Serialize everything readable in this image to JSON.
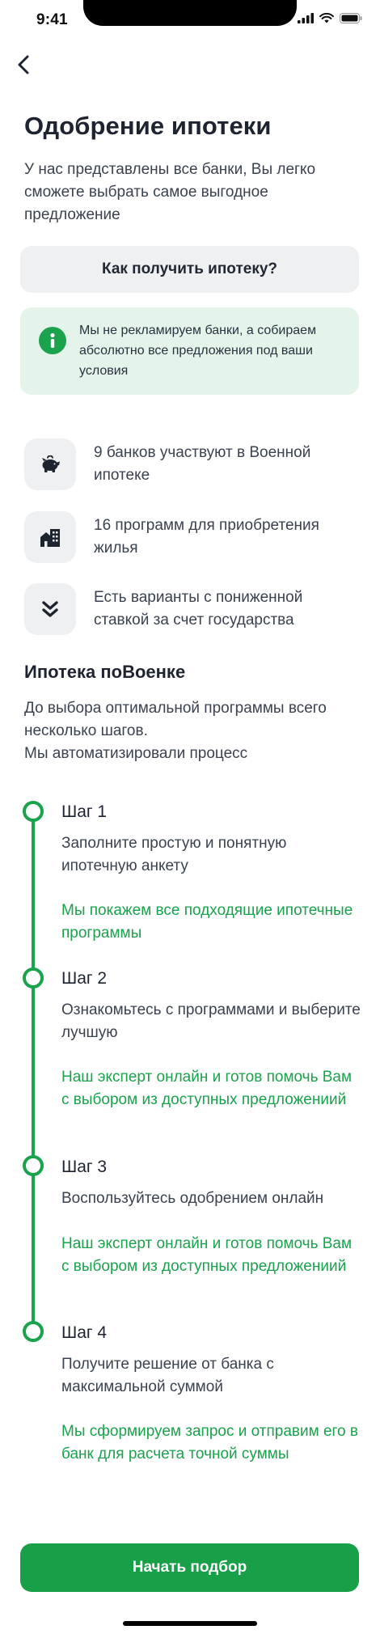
{
  "status_bar": {
    "time": "9:41"
  },
  "header": {
    "title": "Одобрение ипотеки",
    "subtitle": "У нас представлены все банки, Вы легко сможете выбрать самое выгодное предложение"
  },
  "how_button": {
    "label": "Как получить ипотеку?"
  },
  "info_card": {
    "icon": "info-icon",
    "text": "Мы не рекламируем банки, а собираем абсолютно все предложения под ваши условия"
  },
  "features": [
    {
      "icon": "piggy-bank-icon",
      "text": "9 банков участвуют в Военной ипотеке"
    },
    {
      "icon": "buildings-icon",
      "text": "16 программ для приобретения жилья"
    },
    {
      "icon": "double-chevron-down-icon",
      "text": "Есть варианты с пониженной ставкой за счет государства"
    }
  ],
  "section": {
    "title": "Ипотека поВоенке",
    "desc_line1": "До выбора оптимальной программы всего несколько шагов.",
    "desc_line2": "Мы автоматизировали процесс"
  },
  "steps": [
    {
      "title": "Шаг 1",
      "desc": "Заполните простую и понятную ипотечную анкету",
      "note": "Мы покажем все подходящие ипотечные программы"
    },
    {
      "title": "Шаг 2",
      "desc": "Ознакомьтесь с программами и выберите лучшую",
      "note": "Наш эксперт онлайн и готов помочь Вам с выбором из доступных предложениий"
    },
    {
      "title": "Шаг 3",
      "desc": "Воспользуйтесь одобрением онлайн",
      "note": "Наш эксперт онлайн и готов помочь Вам с выбором из доступных предложениий"
    },
    {
      "title": "Шаг 4",
      "desc": "Получите решение от банка с максимальной суммой",
      "note": "Мы сформируем запрос и отправим его в банк для расчета точной суммы"
    }
  ],
  "start_button": {
    "label": "Начать подбор"
  },
  "colors": {
    "accent": "#1aa24c",
    "button": "#17a047",
    "info_bg": "#e4f4ea",
    "chip_bg": "#eef0f2",
    "text": "#1f2733"
  }
}
